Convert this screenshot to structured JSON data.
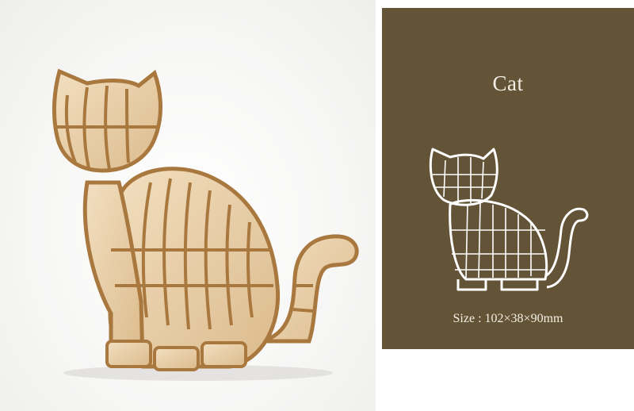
{
  "product": {
    "title": "Cat",
    "size_label": "Size :",
    "size_value": "102×38×90mm"
  },
  "colors": {
    "panel": "#645437",
    "wood": "#e9cfa7",
    "wood_edge": "#a9783f",
    "outline": "#ffffff"
  },
  "icons": {
    "product_photo": "wooden-cat-puzzle",
    "outline": "cat-outline-icon"
  }
}
